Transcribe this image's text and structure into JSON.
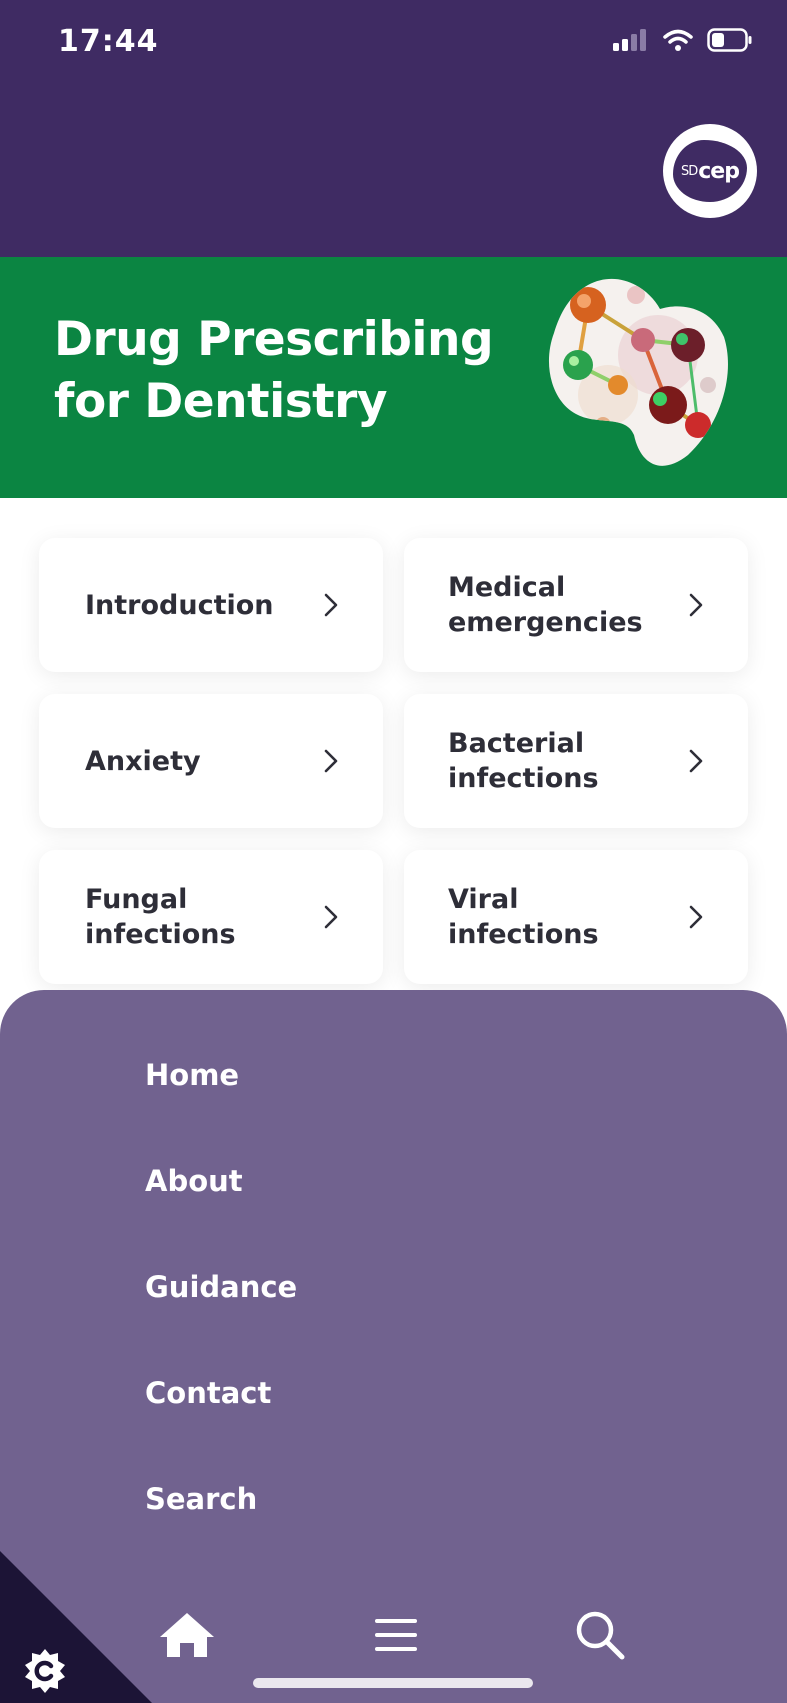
{
  "status_bar": {
    "time": "17:44"
  },
  "header": {
    "logo_text_small": "SD",
    "logo_text_large": "cep"
  },
  "hero": {
    "title": "Drug Prescribing\nfor Dentistry"
  },
  "cards": [
    {
      "label": "Introduction"
    },
    {
      "label": "Medical\nemergencies"
    },
    {
      "label": "Anxiety"
    },
    {
      "label": "Bacterial\ninfections"
    },
    {
      "label": "Fungal\ninfections"
    },
    {
      "label": "Viral infections"
    }
  ],
  "menu": {
    "items": [
      {
        "label": "Home"
      },
      {
        "label": "About"
      },
      {
        "label": "Guidance"
      },
      {
        "label": "Contact"
      },
      {
        "label": "Search"
      }
    ]
  },
  "bottom_nav": {
    "icons": [
      "home-icon",
      "hamburger-menu-icon",
      "search-icon"
    ]
  },
  "colors": {
    "header_purple": "#3f2b63",
    "hero_green": "#0b8542",
    "menu_purple": "#71628f",
    "card_text": "#2e2e38"
  }
}
